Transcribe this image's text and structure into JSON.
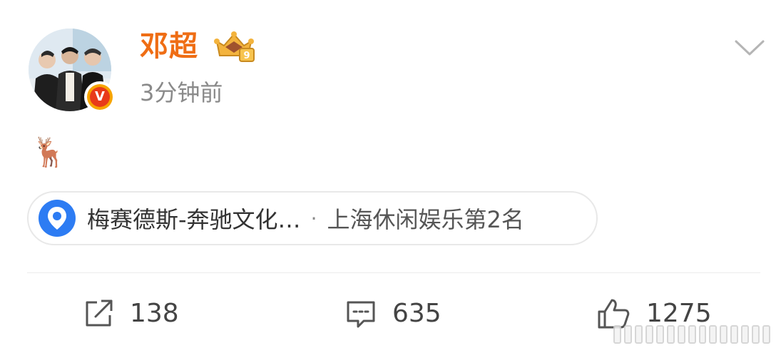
{
  "post": {
    "username": "邓超",
    "timestamp": "3分钟前",
    "body_emoji": "🦌",
    "location": {
      "name": "梅赛德斯-奔驰文化…",
      "separator": "·",
      "rank": "上海休闲娱乐第2名"
    }
  },
  "actions": {
    "repost_count": "138",
    "comment_count": "635",
    "like_count": "1275"
  },
  "badges": {
    "verified_letter": "V",
    "vip_level": "9"
  },
  "colors": {
    "username": "#ef6d14",
    "timestamp": "#8a8a8a",
    "location_icon": "#2d7cf3",
    "verified_badge": "#e83a19",
    "vip_crown": "#f3b33d"
  },
  "icons": {
    "more": "chevron-down-icon",
    "location": "map-pin-icon",
    "repost": "share-icon",
    "comment": "comment-icon",
    "like": "thumbs-up-icon"
  }
}
